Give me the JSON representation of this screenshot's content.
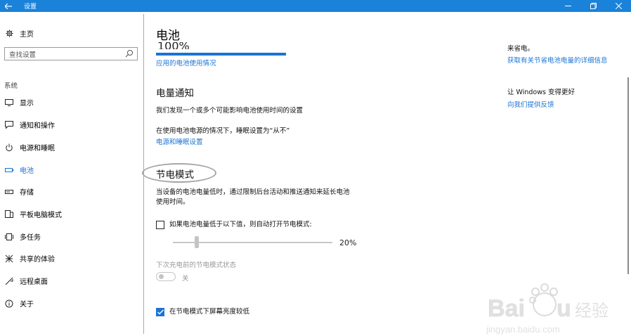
{
  "titlebar": {
    "title": "设置",
    "back_icon": "back-arrow-icon"
  },
  "sidebar": {
    "home_label": "主页",
    "search_placeholder": "查找设置",
    "section_label": "系统",
    "items": [
      {
        "label": "显示",
        "icon": "monitor-icon"
      },
      {
        "label": "通知和操作",
        "icon": "notification-icon"
      },
      {
        "label": "电源和睡眠",
        "icon": "power-icon"
      },
      {
        "label": "电池",
        "icon": "battery-icon",
        "active": true
      },
      {
        "label": "存储",
        "icon": "storage-icon"
      },
      {
        "label": "平板电脑模式",
        "icon": "tablet-icon"
      },
      {
        "label": "多任务",
        "icon": "multitask-icon"
      },
      {
        "label": "共享的体验",
        "icon": "share-icon"
      },
      {
        "label": "远程桌面",
        "icon": "remote-icon"
      },
      {
        "label": "关于",
        "icon": "info-icon"
      }
    ]
  },
  "main": {
    "title": "电池",
    "percent_clipped": "100%",
    "battery_usage_link": "应用的电池使用情况",
    "notify_heading": "电量通知",
    "notify_text": "我们发现一个或多个可能影响电池使用时间的设置",
    "sleep_text": "在使用电池电源的情况下，睡眠设置为“从不”",
    "power_sleep_link": "电源和睡眠设置",
    "saver_heading": "节电模式",
    "saver_desc_1": "当设备的电池电量低时，通过限制后台活动和推送通知来延长电池",
    "saver_desc_2": "使用时间。",
    "auto_checkbox_label": "如果电池电量低于以下值，则自动打开节电模式:",
    "slider_value": "20%",
    "slider_fraction": 0.2,
    "next_charge_label": "下次充电前的节电模式状态",
    "toggle_label": "关",
    "brightness_label": "在节电模式下屏幕亮度较低"
  },
  "right": {
    "partial_text": "来省电。",
    "battery_tips_link": "获取有关节省电池电量的详细信息",
    "feedback_heading": "让 Windows 变得更好",
    "feedback_link": "向我们提供反馈"
  },
  "colors": {
    "accent": "#1a74d4",
    "titlebar": "#1a82d9"
  }
}
